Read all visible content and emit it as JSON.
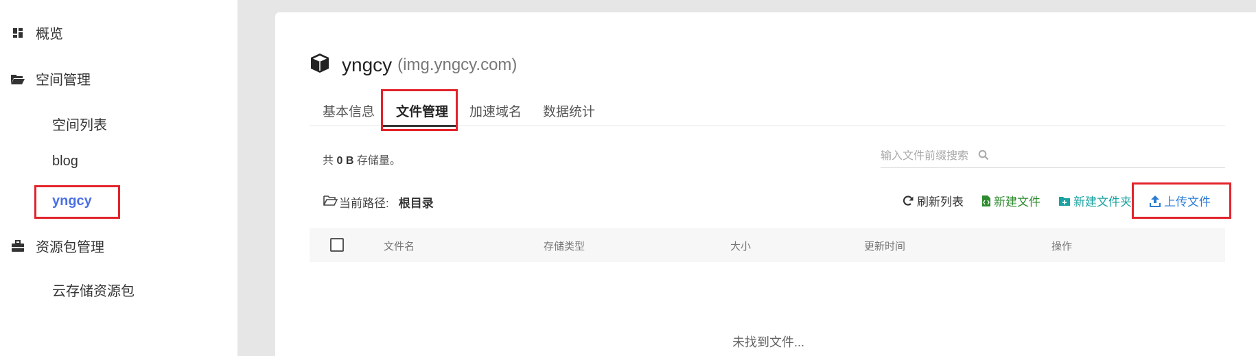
{
  "sidebar": {
    "items": [
      {
        "label": "概览",
        "icon": "dashboard-icon"
      },
      {
        "label": "空间管理",
        "icon": "folder-open-icon"
      },
      {
        "label": "空间列表"
      },
      {
        "label": "blog"
      },
      {
        "label": "yngcy"
      },
      {
        "label": "资源包管理",
        "icon": "briefcase-icon"
      },
      {
        "label": "云存储资源包"
      }
    ]
  },
  "space": {
    "name": "yngcy",
    "domain": "(img.yngcy.com)",
    "icon": "cube-icon"
  },
  "tabs": [
    "基本信息",
    "文件管理",
    "加速域名",
    "数据统计"
  ],
  "active_tab": "文件管理",
  "storage": {
    "prefix": "共",
    "amount": "0 B",
    "suffix": "存储量。"
  },
  "search": {
    "placeholder": "输入文件前缀搜索",
    "icon": "search-icon"
  },
  "path": {
    "label": "当前路径:",
    "value": "根目录"
  },
  "actions": {
    "refresh": "刷新列表",
    "new_file": "新建文件",
    "new_folder": "新建文件夹",
    "upload": "上传文件"
  },
  "table": {
    "columns": [
      "文件名",
      "存储类型",
      "大小",
      "更新时间",
      "操作"
    ],
    "empty_text": "未找到文件..."
  },
  "colors": {
    "active_link": "#4a6fe3",
    "highlight_border": "#e3232b",
    "new_file": "#2d8a2d",
    "new_folder": "#1aa2a2",
    "upload": "#2b7cd3"
  }
}
